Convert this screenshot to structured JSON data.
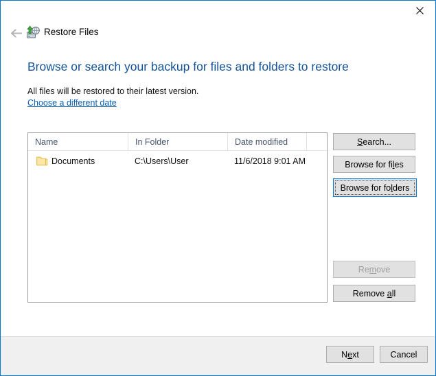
{
  "window": {
    "app_title": "Restore Files",
    "app_icon": "restore-files-icon",
    "close_icon": "close-icon",
    "back_icon": "back-arrow-icon",
    "accent_color": "#0078d7",
    "border_color": "#0078d7"
  },
  "content": {
    "heading": "Browse or search your backup for files and folders to restore",
    "heading_color": "#14539a",
    "subtext": "All files will be restored to their latest version.",
    "date_link": "Choose a different date",
    "link_color": "#0c60b6"
  },
  "file_list": {
    "columns": [
      {
        "label": "Name"
      },
      {
        "label": "In Folder"
      },
      {
        "label": "Date modified"
      },
      {
        "label": ""
      }
    ],
    "rows": [
      {
        "icon": "folder-icon",
        "name": "Documents",
        "in_folder": "C:\\Users\\User",
        "date_modified": "11/6/2018 9:01 AM"
      }
    ]
  },
  "side_buttons": {
    "search": {
      "label_pre": "",
      "label_mn": "S",
      "label_post": "earch...",
      "enabled": true,
      "focused": false
    },
    "browse_files": {
      "label_pre": "Browse for fi",
      "label_mn": "l",
      "label_post": "es",
      "enabled": true,
      "focused": false
    },
    "browse_folders": {
      "label_pre": "Browse for fo",
      "label_mn": "l",
      "label_post": "ders",
      "enabled": true,
      "focused": true
    },
    "remove": {
      "label_pre": "Re",
      "label_mn": "m",
      "label_post": "ove",
      "enabled": false,
      "focused": false
    },
    "remove_all": {
      "label_pre": "Remove ",
      "label_mn": "a",
      "label_post": "ll",
      "enabled": true,
      "focused": false
    }
  },
  "footer_buttons": {
    "next": {
      "label_pre": "N",
      "label_mn": "e",
      "label_post": "xt"
    },
    "cancel": {
      "label_pre": "Cancel",
      "label_mn": "",
      "label_post": ""
    }
  }
}
